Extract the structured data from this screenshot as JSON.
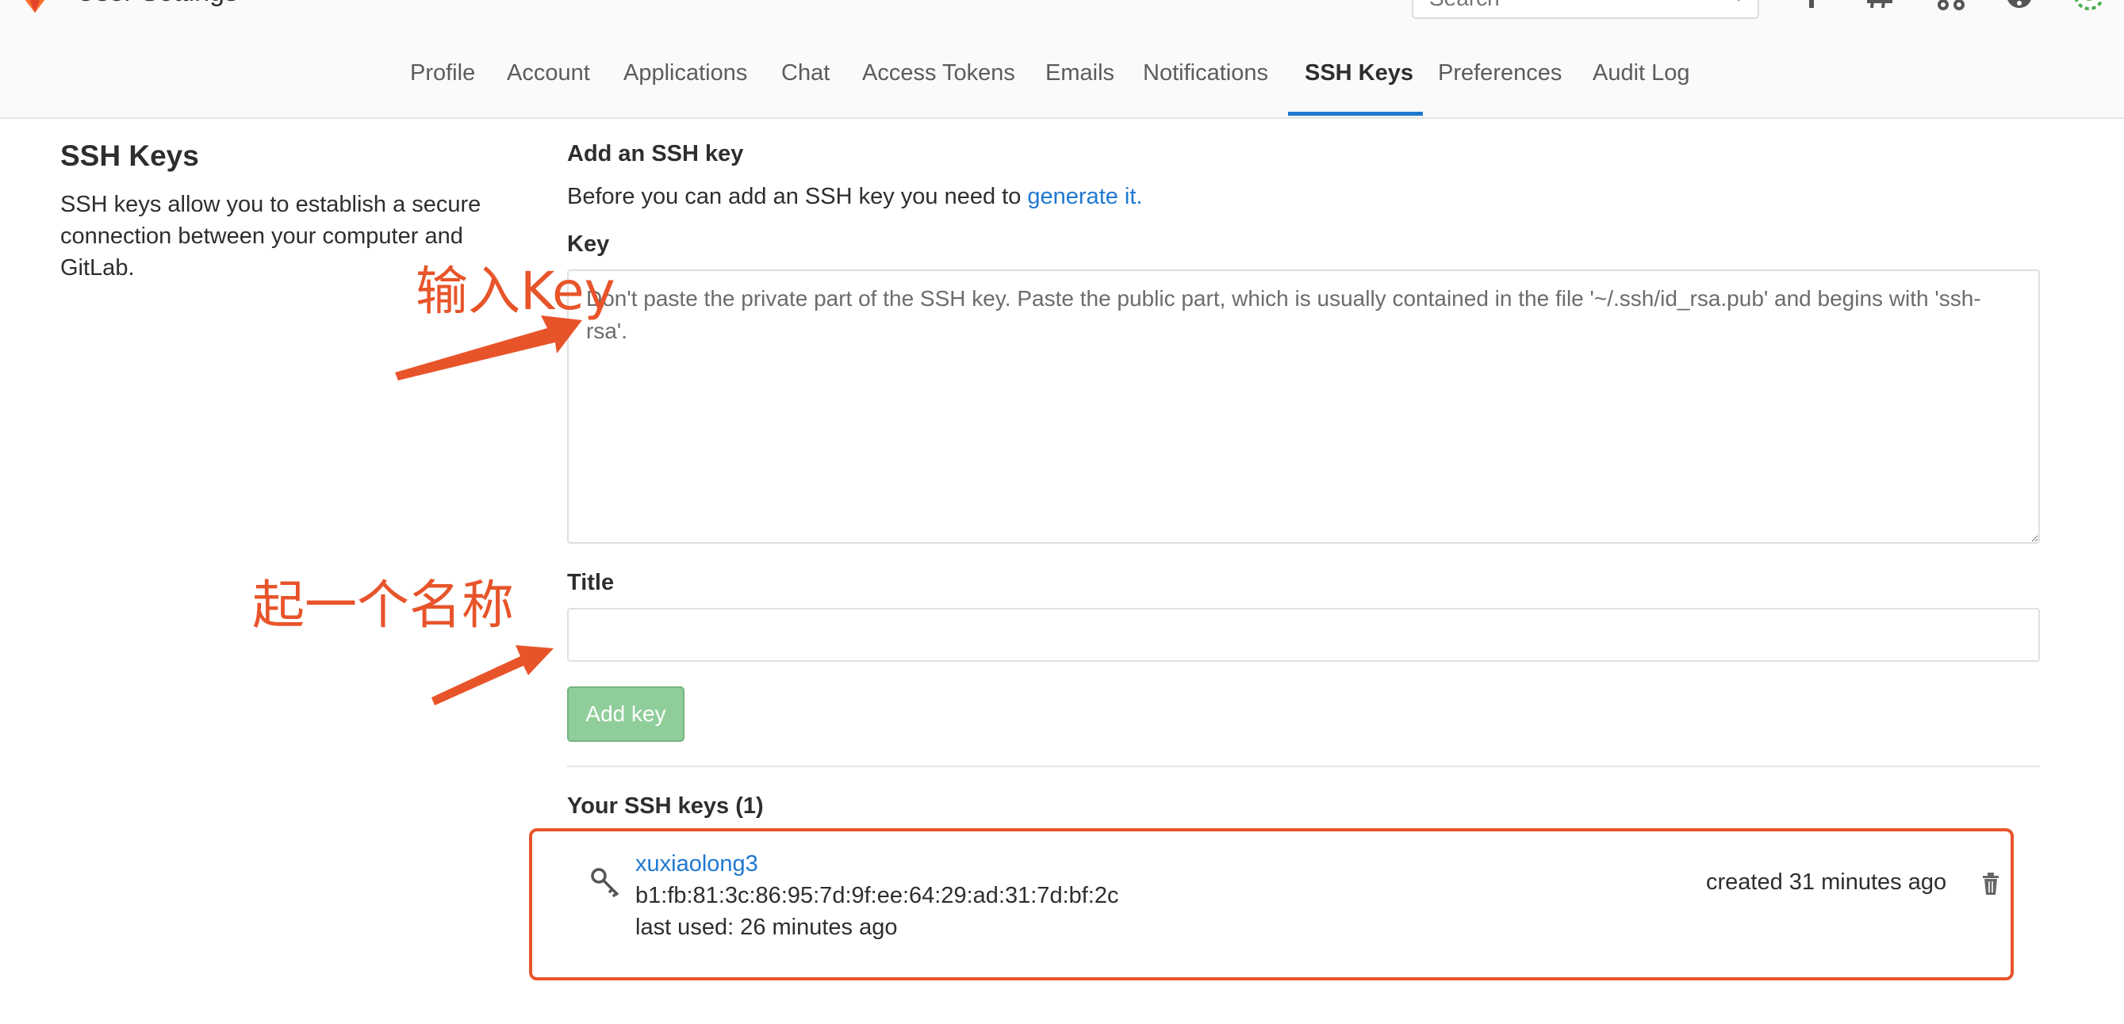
{
  "header": {
    "title": "User Settings",
    "search_placeholder": "Search"
  },
  "tabs": [
    {
      "label": "Profile",
      "active": false
    },
    {
      "label": "Account",
      "active": false
    },
    {
      "label": "Applications",
      "active": false
    },
    {
      "label": "Chat",
      "active": false
    },
    {
      "label": "Access Tokens",
      "active": false
    },
    {
      "label": "Emails",
      "active": false
    },
    {
      "label": "Notifications",
      "active": false
    },
    {
      "label": "SSH Keys",
      "active": true
    },
    {
      "label": "Preferences",
      "active": false
    },
    {
      "label": "Audit Log",
      "active": false
    }
  ],
  "sidebar": {
    "title": "SSH Keys",
    "description": "SSH keys allow you to establish a secure connection between your computer and GitLab."
  },
  "form": {
    "section_title": "Add an SSH key",
    "intro_text": "Before you can add an SSH key you need to ",
    "intro_link": "generate it.",
    "key_label": "Key",
    "key_placeholder": "Don't paste the private part of the SSH key. Paste the public part, which is usually contained in the file '~/.ssh/id_rsa.pub' and begins with 'ssh-rsa'.",
    "title_label": "Title",
    "title_value": "",
    "add_button": "Add key"
  },
  "keys": {
    "heading": "Your SSH keys (1)",
    "items": [
      {
        "name": "xuxiaolong3",
        "fingerprint": "b1:fb:81:3c:86:95:7d:9f:ee:64:29:ad:31:7d:bf:2c",
        "last_used": "last used: 26 minutes ago",
        "created": "created 31 minutes ago"
      }
    ]
  },
  "annotations": {
    "key_hint": "输入Key",
    "title_hint": "起一个名称"
  },
  "colors": {
    "accent": "#1f78d1",
    "annotation": "#e8542a",
    "add_button_bg": "#8fce9a"
  }
}
